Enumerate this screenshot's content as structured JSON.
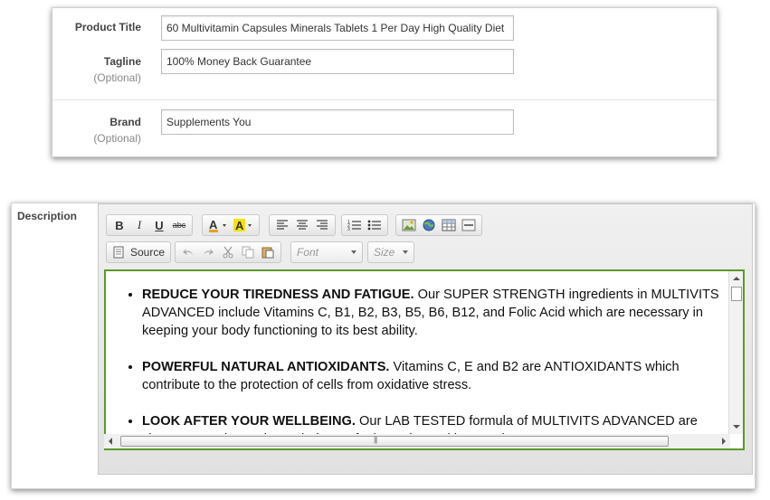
{
  "product": {
    "title_label": "Product Title",
    "title_value": "60 Multivitamin Capsules Minerals Tablets 1 Per Day High Quality Diet",
    "tagline_label": "Tagline",
    "tagline_optional": "(Optional)",
    "tagline_value": "100% Money Back Guarantee",
    "brand_label": "Brand",
    "brand_optional": "(Optional)",
    "brand_value": "Supplements You"
  },
  "description": {
    "label": "Description",
    "toolbar": {
      "bold": "B",
      "italic": "I",
      "underline": "U",
      "strike": "abc",
      "source_label": "Source",
      "font_placeholder": "Font",
      "size_placeholder": "Size"
    },
    "bullets": [
      {
        "bold": "REDUCE YOUR TIREDNESS AND FATIGUE.",
        "text": " Our SUPER STRENGTH ingredients in MULTIVITS ADVANCED include Vitamins C, B1, B2, B3, B5, B6, B12, and Folic Acid which are necessary in keeping your body functioning to its best ability."
      },
      {
        "bold": "POWERFUL NATURAL ANTIOXIDANTS.",
        "text": " Vitamins C, E and B2 are ANTIOXIDANTS which contribute to the protection of cells from oxidative stress."
      },
      {
        "bold": "LOOK AFTER YOUR WELLBEING.",
        "text": " Our LAB TESTED formula of MULTIVITS ADVANCED are chosen to work together to help you feel your best with everyday support"
      }
    ]
  },
  "colors": {
    "editor_focus_border": "#5a9a2a",
    "label_text": "#444444"
  }
}
